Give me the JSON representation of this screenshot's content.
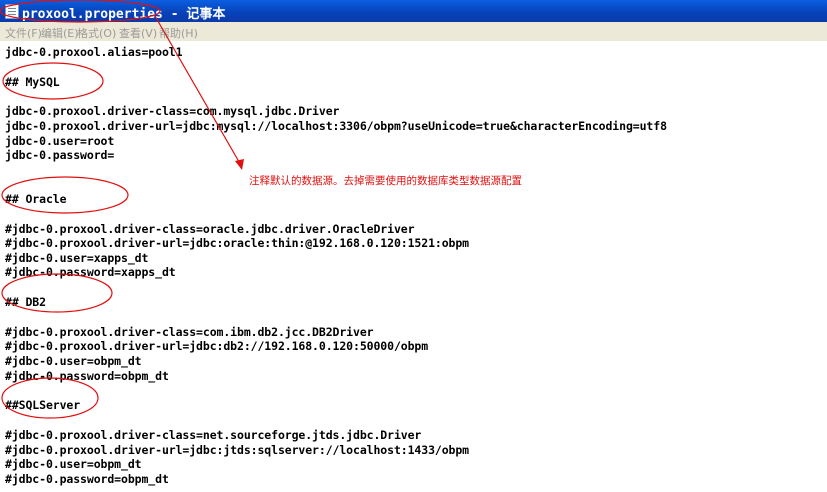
{
  "window": {
    "title": "proxool.properties - 记事本"
  },
  "menu": [
    {
      "label": "文件(F)"
    },
    {
      "label": "编辑(E)"
    },
    {
      "label": "格式(O)"
    },
    {
      "label": "查看(V)"
    },
    {
      "label": "帮助(H)"
    }
  ],
  "lines": [
    "jdbc-0.proxool.alias=pool1",
    "## MySQL",
    "jdbc-0.proxool.driver-class=com.mysql.jdbc.Driver",
    "jdbc-0.proxool.driver-url=jdbc:mysql://localhost:3306/obpm?useUnicode=true&characterEncoding=utf8",
    "jdbc-0.user=root",
    "jdbc-0.password=",
    "## Oracle",
    "#jdbc-0.proxool.driver-class=oracle.jdbc.driver.OracleDriver",
    "#jdbc-0.proxool.driver-url=jdbc:oracle:thin:@192.168.0.120:1521:obpm",
    "#jdbc-0.user=xapps_dt",
    "#jdbc-0.password=xapps_dt",
    "## DB2",
    "#jdbc-0.proxool.driver-class=com.ibm.db2.jcc.DB2Driver",
    "#jdbc-0.proxool.driver-url=jdbc:db2://192.168.0.120:50000/obpm",
    "#jdbc-0.user=obpm_dt",
    "#jdbc-0.password=obpm_dt",
    "##SQLServer",
    "#jdbc-0.proxool.driver-class=net.sourceforge.jtds.jdbc.Driver",
    "#jdbc-0.proxool.driver-url=jdbc:jtds:sqlserver://localhost:1433/obpm",
    "#jdbc-0.user=obpm_dt",
    "#jdbc-0.password=obpm_dt"
  ],
  "annotation": {
    "text": "注释默认的数据源。去掉需要使用的数据库类型数据源配置",
    "color": "#e01010"
  }
}
